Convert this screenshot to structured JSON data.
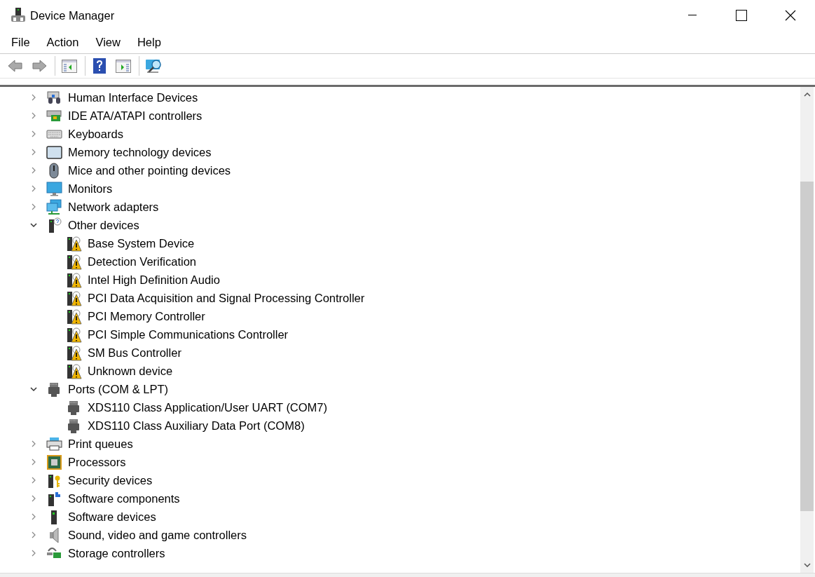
{
  "window": {
    "title": "Device Manager"
  },
  "menu": [
    "File",
    "Action",
    "View",
    "Help"
  ],
  "toolbar": [
    {
      "kind": "back",
      "disabled": true
    },
    {
      "kind": "forward",
      "disabled": true
    },
    {
      "kind": "tree"
    },
    {
      "kind": "help"
    },
    {
      "kind": "pane"
    },
    {
      "kind": "scan"
    }
  ],
  "tree": [
    {
      "label": "Human Interface Devices",
      "expanded": false
    },
    {
      "label": "IDE ATA/ATAPI controllers",
      "expanded": false
    },
    {
      "label": "Keyboards",
      "expanded": false
    },
    {
      "label": "Memory technology devices",
      "expanded": false
    },
    {
      "label": "Mice and other pointing devices",
      "expanded": false
    },
    {
      "label": "Monitors",
      "expanded": false
    },
    {
      "label": "Network adapters",
      "expanded": false
    },
    {
      "label": "Other devices",
      "expanded": true,
      "children": [
        {
          "label": "Base System Device"
        },
        {
          "label": "Detection Verification"
        },
        {
          "label": "Intel High Definition Audio"
        },
        {
          "label": "PCI Data Acquisition and Signal Processing Controller"
        },
        {
          "label": "PCI Memory Controller"
        },
        {
          "label": "PCI Simple Communications Controller"
        },
        {
          "label": "SM Bus Controller"
        },
        {
          "label": "Unknown device"
        }
      ]
    },
    {
      "label": "Ports (COM & LPT)",
      "expanded": true,
      "children": [
        {
          "label": "XDS110 Class Application/User UART (COM7)"
        },
        {
          "label": "XDS110 Class Auxiliary Data Port (COM8)"
        }
      ]
    },
    {
      "label": "Print queues",
      "expanded": false
    },
    {
      "label": "Processors",
      "expanded": false
    },
    {
      "label": "Security devices",
      "expanded": false
    },
    {
      "label": "Software components",
      "expanded": false
    },
    {
      "label": "Software devices",
      "expanded": false
    },
    {
      "label": "Sound, video and game controllers",
      "expanded": false
    },
    {
      "label": "Storage controllers",
      "expanded": false
    }
  ]
}
